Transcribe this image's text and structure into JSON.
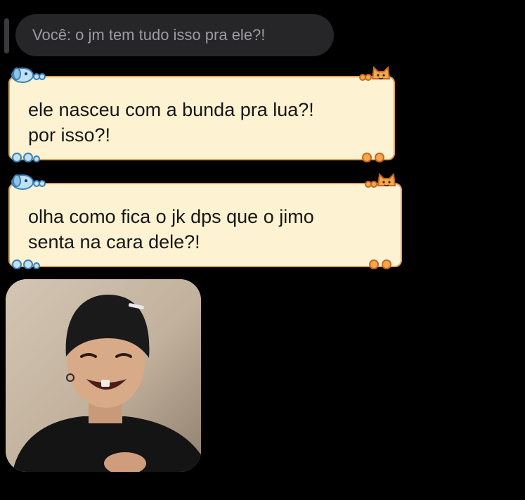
{
  "reply": {
    "text": "Você: o jm tem tudo isso pra ele?!"
  },
  "messages": [
    {
      "lines": [
        "ele nasceu com a bunda pra lua?!",
        "por isso?!"
      ]
    },
    {
      "lines": [
        "olha como fica o jk dps que o jimo",
        "senta na cara dele?!"
      ]
    }
  ],
  "attachment": {
    "icon": "photo-message"
  },
  "colors": {
    "background": "#000000",
    "reply_bg": "#262628",
    "reply_text": "#9c9ca1",
    "bubble_bg": "#fdf2d1",
    "bubble_border": "#e3a154",
    "bubble_text": "#161616"
  }
}
